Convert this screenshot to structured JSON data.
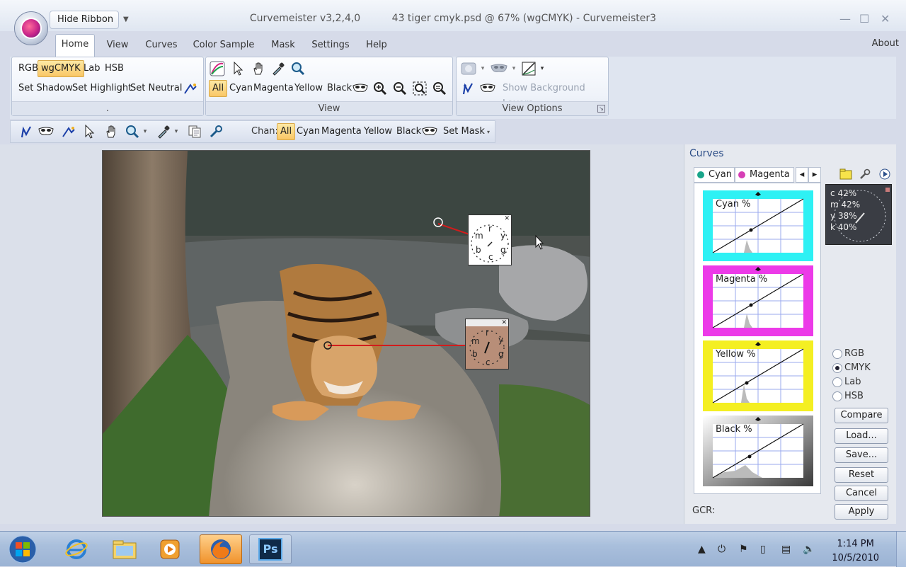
{
  "window": {
    "app_title": "Curvemeister v3,2,4,0",
    "doc_title": "43 tiger cmyk.psd @ 67% (wgCMYK)",
    "app_name": "Curvemeister3",
    "separator": "-",
    "hide_ribbon": "Hide Ribbon",
    "minimize": "—",
    "maximize": "☐",
    "close": "✕"
  },
  "tabs": [
    "Home",
    "View",
    "Curves",
    "Color Sample",
    "Mask",
    "Settings",
    "Help"
  ],
  "active_tab": "Home",
  "about": "About",
  "ribbon": {
    "mode_buttons": [
      "RGB",
      "wgCMYK",
      "Lab",
      "HSB"
    ],
    "selected_mode": "wgCMYK",
    "set_buttons": [
      "Set Shadow",
      "Set Highlight",
      "Set Neutral"
    ],
    "group1_label": ".",
    "channel_buttons": [
      "All",
      "Cyan",
      "Magenta",
      "Yellow",
      "Black"
    ],
    "selected_channel": "All",
    "group2_label": "View",
    "show_bg_layers": "Show Background Layers",
    "group3_label": "View Options"
  },
  "toolbar": {
    "chan_label": "Chan:",
    "channel_buttons": [
      "All",
      "Cyan",
      "Magenta",
      "Yellow",
      "Black"
    ],
    "set_mask": "Set Mask"
  },
  "sample_points": [
    {
      "letters": [
        "r",
        "y",
        "g",
        "c",
        "b",
        "m"
      ]
    },
    {
      "letters": [
        "r",
        "y",
        "g",
        "c",
        "b",
        "m"
      ]
    }
  ],
  "curves_panel": {
    "title": "Curves",
    "tabs": [
      {
        "label": "Cyan",
        "color": "#19a58a"
      },
      {
        "label": "Magenta",
        "color": "#d63fb5"
      }
    ],
    "curves": [
      {
        "label": "Cyan %",
        "color": "#2ef1f4"
      },
      {
        "label": "Magenta %",
        "color": "#ec3ae8"
      },
      {
        "label": "Yellow %",
        "color": "#f4ef22"
      },
      {
        "label": "Black %",
        "color": "#3a3a3a"
      }
    ],
    "gauge": [
      {
        "k": "c",
        "v": "42%"
      },
      {
        "k": "m",
        "v": "42%"
      },
      {
        "k": "y",
        "v": "38%"
      },
      {
        "k": "k",
        "v": "40%"
      }
    ],
    "color_modes": [
      "RGB",
      "CMYK",
      "Lab",
      "HSB"
    ],
    "selected_color_mode": "CMYK",
    "compare": "Compare",
    "load": "Load...",
    "save": "Save...",
    "reset": "Reset",
    "cancel": "Cancel",
    "apply": "Apply",
    "gcr_label": "GCR:"
  },
  "taskbar": {
    "time": "1:14 PM",
    "date": "10/5/2010",
    "ps_label": "Ps"
  }
}
